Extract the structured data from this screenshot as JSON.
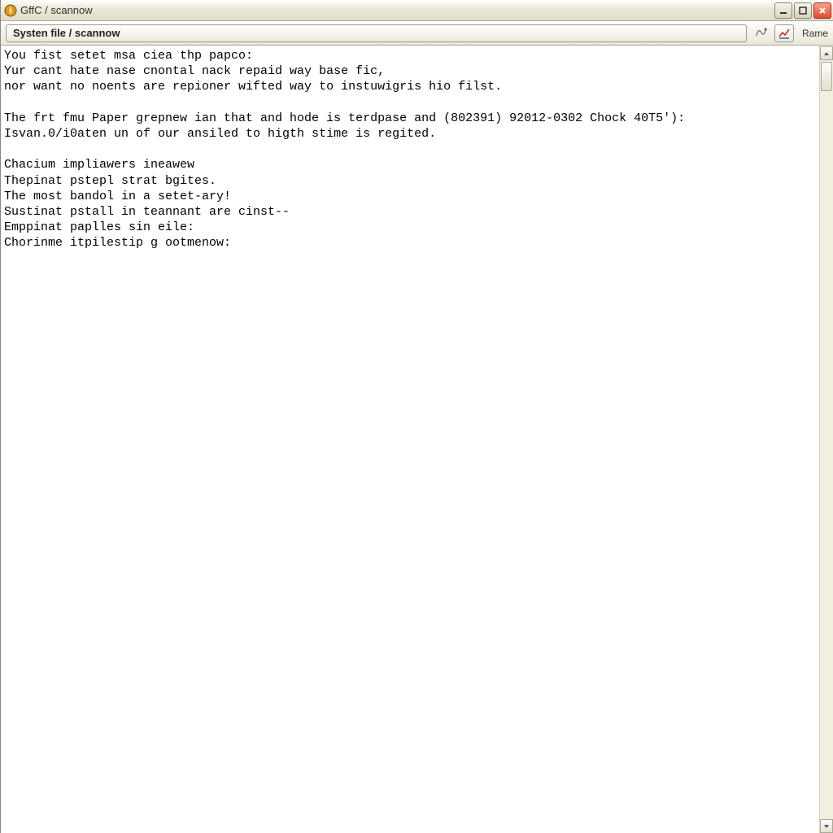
{
  "titlebar": {
    "app_name": "GffC",
    "path": "/ scannow"
  },
  "toolbar": {
    "address": "Systen file / scannow",
    "right_label": "Rame"
  },
  "body_lines": [
    "You fist setet msa ciea thp papco:",
    "Yur cant hate nase cnontal nack repaid way base fic,",
    "nor want no noents are repioner wifted way to instuwigris hio filst.",
    "",
    "The frt fmu Paper grepnew ian that and hode is terdpase and (802391) 92012-0302 Chock 40T5'):",
    "Isvan.0/i0aten un of our ansiled to higth stime is regited.",
    "",
    "Chacium impliawers ineawew",
    "Thepinat pstepl strat bgites.",
    "The most bandol in a setet-ary!",
    "Sustinat pstall in teannant are cinst--",
    "Emppinat paplles sin eile:",
    "Chorinme itpilestip g ootmenow:"
  ],
  "icons": {
    "app": "🛡",
    "gear": "⚙",
    "chart": "📈"
  }
}
